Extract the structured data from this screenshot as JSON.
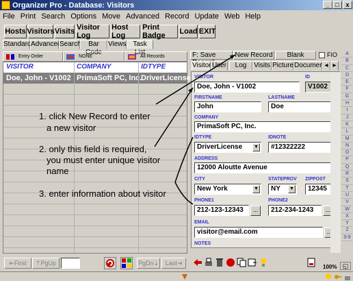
{
  "window": {
    "title": "Organizer Pro - Database: Visitors",
    "min": "_",
    "max": "□",
    "close": "x"
  },
  "menu": [
    "File",
    "Print",
    "Search",
    "Options",
    "Move",
    "Advanced",
    "Record",
    "Update",
    "Web",
    "Help"
  ],
  "toolbar": [
    "Hosts",
    "Visitors",
    "Visits",
    "Visitor Log",
    "Host Log",
    "Print Badge",
    "Load",
    "EXIT"
  ],
  "tabs": [
    "Standard",
    "Advanced",
    "Search",
    "Bar Code",
    "Views",
    "Task List"
  ],
  "list_toolbar": {
    "entry_order": "Entry Order",
    "none": "NONE",
    "all_records": "All Records"
  },
  "grid": {
    "columns": [
      "VISITOR",
      "COMPANY",
      "IDTYPE"
    ],
    "rows": [
      [
        "Doe, John - V1002",
        "PrimaSoft PC, Inc.",
        "DriverLicense"
      ]
    ]
  },
  "nav": {
    "first": "First",
    "pgup": "PgUp",
    "pgdn": "PgDn",
    "last": "Last"
  },
  "record_buttons": {
    "save": "Save Record",
    "new": "New Record",
    "blank": "Blank",
    "f_label": "F:",
    "fio": "FIO"
  },
  "record_tabs": [
    "Visitor",
    "User",
    "Log",
    "Visits",
    "Picture",
    "Document"
  ],
  "form": {
    "visitor": {
      "label": "VISITOR",
      "value": "Doe, John - V1002"
    },
    "id": {
      "label": "ID",
      "value": "V1002"
    },
    "firstname": {
      "label": "FIRSTNAME",
      "value": "John"
    },
    "lastname": {
      "label": "LASTNAME",
      "value": "Doe"
    },
    "company": {
      "label": "COMPANY",
      "value": "PrimaSoft PC, Inc."
    },
    "idtype": {
      "label": "IDTYPE",
      "value": "DriverLicense"
    },
    "idnote": {
      "label": "IDNOTE",
      "value": "#12322222"
    },
    "address": {
      "label": "ADDRESS",
      "value": "12000 Aloutte Avenue"
    },
    "city": {
      "label": "CITY",
      "value": "New York"
    },
    "stateprov": {
      "label": "STATEPROV",
      "value": "NY"
    },
    "zippost": {
      "label": "ZIPPOST",
      "value": "12345"
    },
    "phone1": {
      "label": "PHONE1",
      "value": "212-123-12343"
    },
    "phone2": {
      "label": "PHONE2",
      "value": "212-234-1243"
    },
    "email": {
      "label": "EMAIL",
      "value": "visitor@email.com"
    },
    "notes": {
      "label": "NOTES"
    }
  },
  "alpha": [
    "A",
    "B",
    "C",
    "D",
    "E",
    "F",
    "G",
    "H",
    "I",
    "J",
    "K",
    "L",
    "M",
    "N",
    "O",
    "P",
    "Q",
    "R",
    "S",
    "T",
    "U",
    "V",
    "W",
    "X",
    "Y",
    "Z",
    "0-9"
  ],
  "annotations": [
    "1. click New Record to enter",
    "a new visitor",
    "2. only this field is required,",
    "you must enter unique visitor",
    "name",
    "3. enter information about visitor"
  ],
  "zoom": "100%",
  "ellipsis": "...",
  "dropdown": "▼"
}
